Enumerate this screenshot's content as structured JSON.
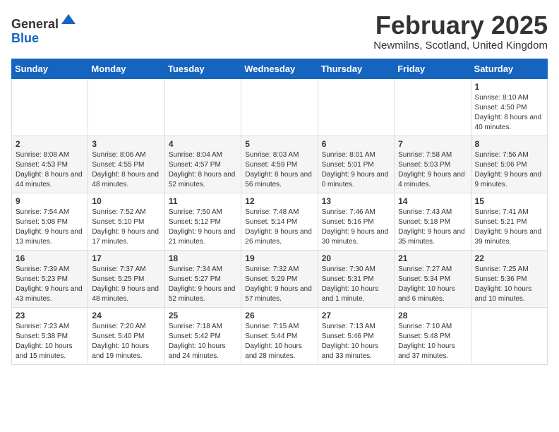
{
  "logo": {
    "general": "General",
    "blue": "Blue"
  },
  "header": {
    "month": "February 2025",
    "location": "Newmilns, Scotland, United Kingdom"
  },
  "weekdays": [
    "Sunday",
    "Monday",
    "Tuesday",
    "Wednesday",
    "Thursday",
    "Friday",
    "Saturday"
  ],
  "weeks": [
    [
      {
        "day": "",
        "info": ""
      },
      {
        "day": "",
        "info": ""
      },
      {
        "day": "",
        "info": ""
      },
      {
        "day": "",
        "info": ""
      },
      {
        "day": "",
        "info": ""
      },
      {
        "day": "",
        "info": ""
      },
      {
        "day": "1",
        "info": "Sunrise: 8:10 AM\nSunset: 4:50 PM\nDaylight: 8 hours and 40 minutes."
      }
    ],
    [
      {
        "day": "2",
        "info": "Sunrise: 8:08 AM\nSunset: 4:53 PM\nDaylight: 8 hours and 44 minutes."
      },
      {
        "day": "3",
        "info": "Sunrise: 8:06 AM\nSunset: 4:55 PM\nDaylight: 8 hours and 48 minutes."
      },
      {
        "day": "4",
        "info": "Sunrise: 8:04 AM\nSunset: 4:57 PM\nDaylight: 8 hours and 52 minutes."
      },
      {
        "day": "5",
        "info": "Sunrise: 8:03 AM\nSunset: 4:59 PM\nDaylight: 8 hours and 56 minutes."
      },
      {
        "day": "6",
        "info": "Sunrise: 8:01 AM\nSunset: 5:01 PM\nDaylight: 9 hours and 0 minutes."
      },
      {
        "day": "7",
        "info": "Sunrise: 7:58 AM\nSunset: 5:03 PM\nDaylight: 9 hours and 4 minutes."
      },
      {
        "day": "8",
        "info": "Sunrise: 7:56 AM\nSunset: 5:06 PM\nDaylight: 9 hours and 9 minutes."
      }
    ],
    [
      {
        "day": "9",
        "info": "Sunrise: 7:54 AM\nSunset: 5:08 PM\nDaylight: 9 hours and 13 minutes."
      },
      {
        "day": "10",
        "info": "Sunrise: 7:52 AM\nSunset: 5:10 PM\nDaylight: 9 hours and 17 minutes."
      },
      {
        "day": "11",
        "info": "Sunrise: 7:50 AM\nSunset: 5:12 PM\nDaylight: 9 hours and 21 minutes."
      },
      {
        "day": "12",
        "info": "Sunrise: 7:48 AM\nSunset: 5:14 PM\nDaylight: 9 hours and 26 minutes."
      },
      {
        "day": "13",
        "info": "Sunrise: 7:46 AM\nSunset: 5:16 PM\nDaylight: 9 hours and 30 minutes."
      },
      {
        "day": "14",
        "info": "Sunrise: 7:43 AM\nSunset: 5:18 PM\nDaylight: 9 hours and 35 minutes."
      },
      {
        "day": "15",
        "info": "Sunrise: 7:41 AM\nSunset: 5:21 PM\nDaylight: 9 hours and 39 minutes."
      }
    ],
    [
      {
        "day": "16",
        "info": "Sunrise: 7:39 AM\nSunset: 5:23 PM\nDaylight: 9 hours and 43 minutes."
      },
      {
        "day": "17",
        "info": "Sunrise: 7:37 AM\nSunset: 5:25 PM\nDaylight: 9 hours and 48 minutes."
      },
      {
        "day": "18",
        "info": "Sunrise: 7:34 AM\nSunset: 5:27 PM\nDaylight: 9 hours and 52 minutes."
      },
      {
        "day": "19",
        "info": "Sunrise: 7:32 AM\nSunset: 5:29 PM\nDaylight: 9 hours and 57 minutes."
      },
      {
        "day": "20",
        "info": "Sunrise: 7:30 AM\nSunset: 5:31 PM\nDaylight: 10 hours and 1 minute."
      },
      {
        "day": "21",
        "info": "Sunrise: 7:27 AM\nSunset: 5:34 PM\nDaylight: 10 hours and 6 minutes."
      },
      {
        "day": "22",
        "info": "Sunrise: 7:25 AM\nSunset: 5:36 PM\nDaylight: 10 hours and 10 minutes."
      }
    ],
    [
      {
        "day": "23",
        "info": "Sunrise: 7:23 AM\nSunset: 5:38 PM\nDaylight: 10 hours and 15 minutes."
      },
      {
        "day": "24",
        "info": "Sunrise: 7:20 AM\nSunset: 5:40 PM\nDaylight: 10 hours and 19 minutes."
      },
      {
        "day": "25",
        "info": "Sunrise: 7:18 AM\nSunset: 5:42 PM\nDaylight: 10 hours and 24 minutes."
      },
      {
        "day": "26",
        "info": "Sunrise: 7:15 AM\nSunset: 5:44 PM\nDaylight: 10 hours and 28 minutes."
      },
      {
        "day": "27",
        "info": "Sunrise: 7:13 AM\nSunset: 5:46 PM\nDaylight: 10 hours and 33 minutes."
      },
      {
        "day": "28",
        "info": "Sunrise: 7:10 AM\nSunset: 5:48 PM\nDaylight: 10 hours and 37 minutes."
      },
      {
        "day": "",
        "info": ""
      }
    ]
  ]
}
